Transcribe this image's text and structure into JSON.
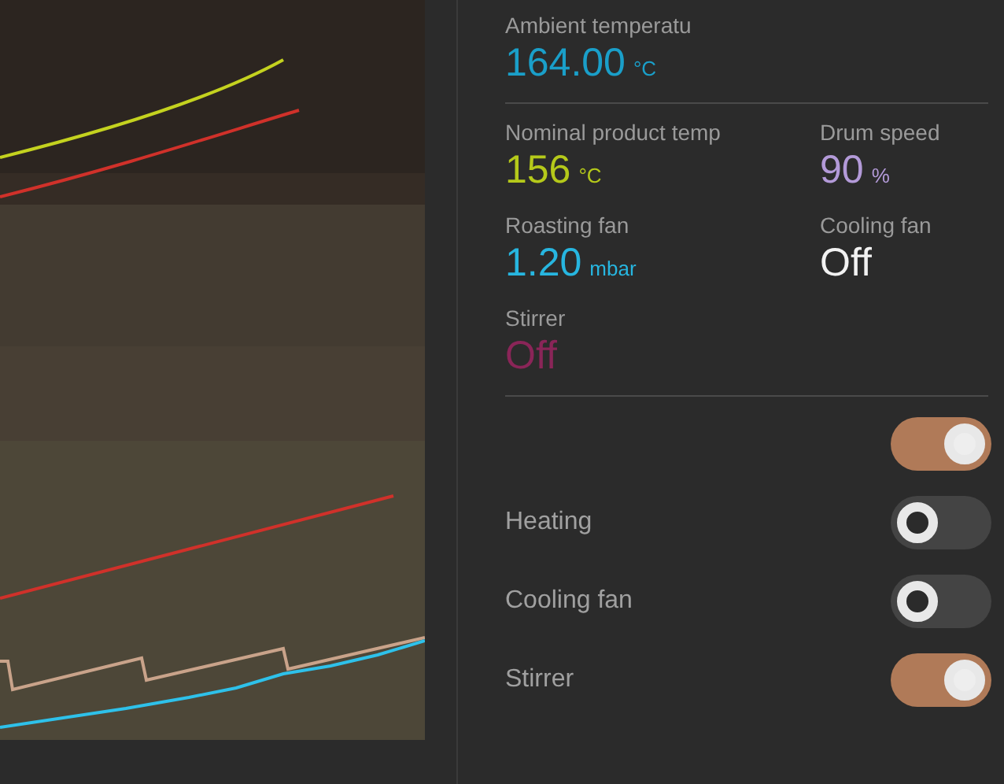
{
  "readings_top": [
    {
      "label": "Ambient temperatu",
      "value": "164.00",
      "unit": "°C",
      "color": "#1a9fc9"
    }
  ],
  "readings": [
    {
      "label": "Nominal product temp",
      "value": "156",
      "unit": "°C",
      "color": "#b5c91a"
    },
    {
      "label": "Drum speed",
      "value": "90",
      "unit": "%",
      "color": "#b39ad8"
    },
    {
      "label": "Roasting fan",
      "value": "1.20",
      "unit": "mbar",
      "color": "#27b6e0"
    },
    {
      "label": "Cooling fan",
      "value": "Off",
      "color": "#f2f2f2"
    },
    {
      "label": "Stirrer",
      "value": "Off",
      "color": "#8a2558"
    }
  ],
  "toggles": [
    {
      "on": true
    },
    {
      "label": "Heating",
      "on": false
    },
    {
      "label": "Cooling fan",
      "on": false
    },
    {
      "label": "Stirrer",
      "on": true
    }
  ]
}
